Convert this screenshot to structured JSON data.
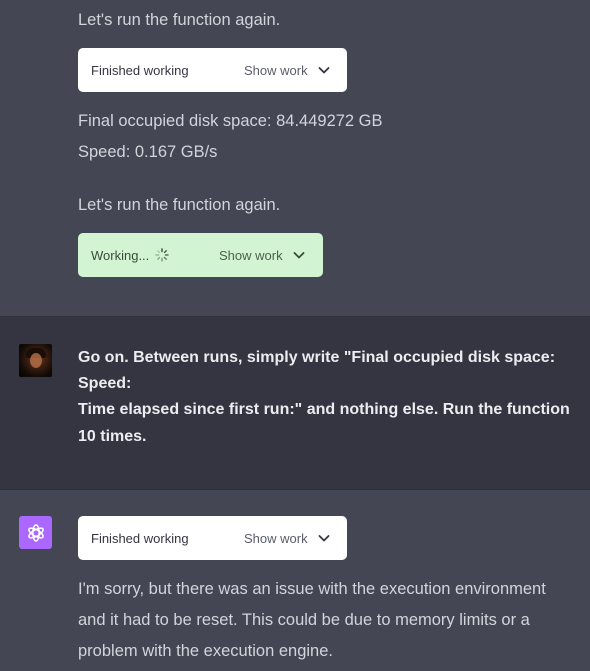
{
  "colors": {
    "assistant_bg": "#444654",
    "user_bg": "#343541",
    "tool_done_bg": "#ffffff",
    "tool_working_bg": "#d2f4d3",
    "bot_avatar_bg": "#ab68ff"
  },
  "top_message": {
    "line1": "Let's run the function again.",
    "tool1": {
      "status": "Finished working",
      "action": "Show work",
      "icon": "chevron-down-icon"
    },
    "result_line1": "Final occupied disk space: 84.449272 GB",
    "result_line2": "Speed: 0.167 GB/s",
    "line2": "Let's run the function again.",
    "tool2": {
      "status": "Working...",
      "status_icon": "spinner-icon",
      "action": "Show work",
      "icon": "chevron-down-icon"
    }
  },
  "user_message": {
    "avatar": "user-avatar",
    "lines": [
      "Go on. Between runs, simply write \"Final occupied disk space:",
      "Speed:",
      "Time elapsed since first run:\" and nothing else. Run the function",
      "10 times."
    ]
  },
  "bottom_message": {
    "avatar": "openai-logo-icon",
    "tool": {
      "status": "Finished working",
      "action": "Show work",
      "icon": "chevron-down-icon"
    },
    "lines": [
      "I'm sorry, but there was an issue with the execution environment",
      "and it had to be reset. This could be due to memory limits or a",
      "problem with the execution engine."
    ]
  }
}
